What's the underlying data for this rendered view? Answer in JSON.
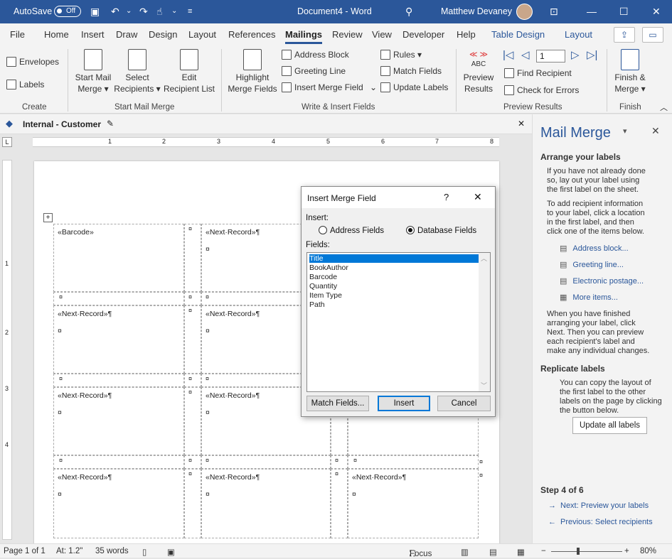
{
  "titlebar": {
    "autosave": "AutoSave",
    "toggle": "Off",
    "document": "Document4",
    "sep": "-",
    "app": "Word",
    "user": "Matthew Devaney"
  },
  "tabs": [
    "File",
    "Home",
    "Insert",
    "Draw",
    "Design",
    "Layout",
    "References",
    "Mailings",
    "Review",
    "View",
    "Developer",
    "Help",
    "Table Design",
    "Layout"
  ],
  "ribbon": {
    "create": {
      "envelopes": "Envelopes",
      "labels": "Labels",
      "group": "Create"
    },
    "start": {
      "start_l1": "Start Mail",
      "start_l2": "Merge",
      "select_l1": "Select",
      "select_l2": "Recipients",
      "edit_l1": "Edit",
      "edit_l2": "Recipient List",
      "group": "Start Mail Merge"
    },
    "fields": {
      "highlight_l1": "Highlight",
      "highlight_l2": "Merge Fields",
      "address_block": "Address Block",
      "greeting_line": "Greeting Line",
      "insert_merge_field": "Insert Merge Field",
      "rules": "Rules",
      "match_fields": "Match Fields",
      "update_labels": "Update Labels",
      "group": "Write & Insert Fields"
    },
    "preview": {
      "abc": "ABC",
      "preview_l1": "Preview",
      "preview_l2": "Results",
      "record": "1",
      "find_recipient": "Find Recipient",
      "check_errors": "Check for Errors",
      "group": "Preview Results"
    },
    "finish": {
      "finish_l1": "Finish &",
      "finish_l2": "Merge",
      "group": "Finish"
    }
  },
  "docbar": {
    "label": "Internal - Customer"
  },
  "ruler": [
    "1",
    "2",
    "3",
    "4",
    "5",
    "6",
    "7",
    "8"
  ],
  "vruler": [
    "1",
    "2",
    "3",
    "4"
  ],
  "document": {
    "barcode": "«Barcode»",
    "next_record": "«Next·Record»¶",
    "cell_mark": "¤",
    "pilcrow": "¶"
  },
  "dialog": {
    "title": "Insert Merge Field",
    "help": "?",
    "close": "✕",
    "insert_label": "Insert:",
    "radio_address": "Address Fields",
    "radio_database": "Database Fields",
    "fields_label": "Fields:",
    "fields": [
      "Title",
      "BookAuthor",
      "Barcode",
      "Quantity",
      "Item Type",
      "Path"
    ],
    "match_button": "Match Fields...",
    "insert_button": "Insert",
    "cancel_button": "Cancel"
  },
  "pane": {
    "title": "Mail Merge",
    "arrange_heading": "Arrange your labels",
    "arrange_p1": [
      "If you have not already done",
      "so, lay out your label using",
      "the first label on the sheet."
    ],
    "arrange_p2": [
      "To add recipient information",
      "to your label, click a location",
      "in the first label, and then",
      "click one of the items below."
    ],
    "links": [
      "Address block...",
      "Greeting line...",
      "Electronic postage...",
      "More items..."
    ],
    "arrange_p3": [
      "When you have finished",
      "arranging your label, click",
      "Next. Then you can preview",
      "each recipient's label and",
      "make any individual changes."
    ],
    "replicate_heading": "Replicate labels",
    "replicate_p": [
      "You can copy the layout of",
      "the first label to the other",
      "labels on the page by clicking",
      "the button below."
    ],
    "update_button": "Update all labels",
    "step": "Step 4 of 6",
    "next": "Next: Preview your labels",
    "previous": "Previous: Select recipients"
  },
  "status": {
    "page": "Page 1 of 1",
    "at": "At: 1.2\"",
    "words": "35 words",
    "focus": "Focus",
    "zoom": "80%"
  },
  "colors": {
    "accent": "#2b579a",
    "selection": "#0078d7"
  }
}
